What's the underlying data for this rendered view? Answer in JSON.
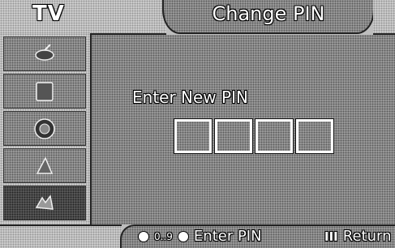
{
  "header": {
    "source_label": "TV",
    "title": "Change PIN"
  },
  "sidebar": {
    "items": [
      {
        "icon": "antenna-icon"
      },
      {
        "icon": "picture-icon"
      },
      {
        "icon": "sound-icon"
      },
      {
        "icon": "channel-icon"
      },
      {
        "icon": "setup-icon"
      }
    ]
  },
  "main": {
    "prompt": "Enter New PIN",
    "pin_digits": [
      "",
      "",
      "",
      ""
    ]
  },
  "footer": {
    "enter_keys": "0..9",
    "enter_label": "Enter PIN",
    "return_icon": "III",
    "return_label": "Return"
  },
  "colors": {
    "text": "#ffffff",
    "panel": "#9c9c9c",
    "outline": "#222222"
  }
}
